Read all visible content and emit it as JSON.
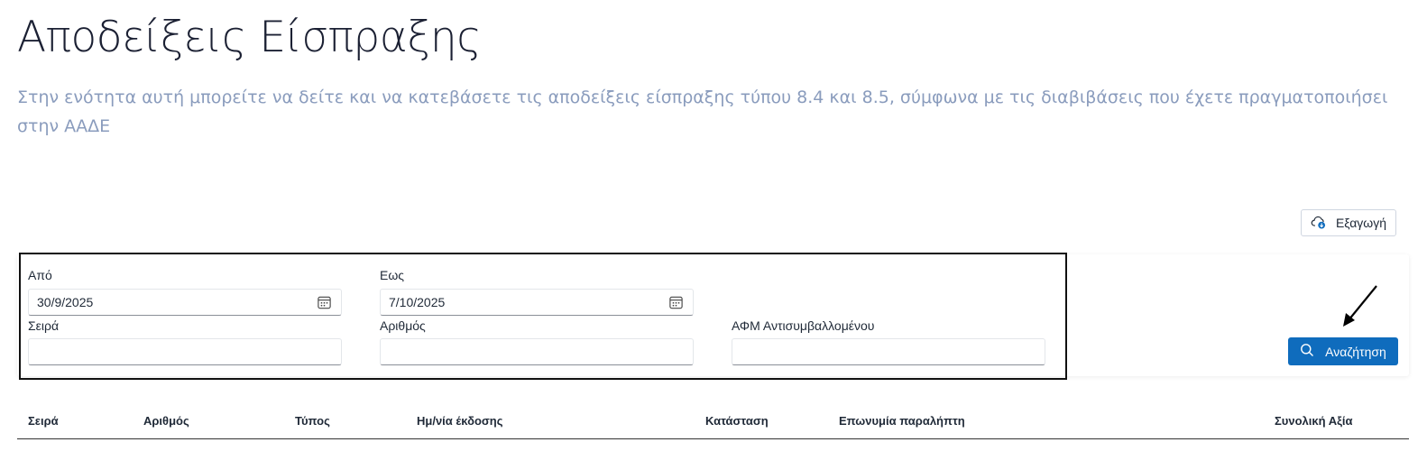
{
  "page": {
    "title": "Αποδείξεις Είσπραξης",
    "description": "Στην ενότητα αυτή μπορείτε να δείτε και να κατεβάσετε τις αποδείξεις είσπραξης τύπου 8.4 και 8.5, σύμφωνα με τις διαβιβάσεις που έχετε πραγματοποιήσει στην ΑΑΔΕ"
  },
  "toolbar": {
    "export_label": "Εξαγωγή",
    "export_icon": "cloud-download-icon"
  },
  "filters": {
    "from_label": "Από",
    "from_value": "30/9/2025",
    "to_label": "Εως",
    "to_value": "7/10/2025",
    "series_label": "Σειρά",
    "series_value": "",
    "number_label": "Αριθμός",
    "number_value": "",
    "vat_label": "ΑΦΜ Αντισυμβαλλομένου",
    "vat_value": "",
    "search_label": "Αναζήτηση",
    "search_icon": "search-icon"
  },
  "table": {
    "columns": [
      "Σειρά",
      "Αριθμός",
      "Τύπος",
      "Ημ/νία έκδοσης",
      "Κατάσταση",
      "Επωνυμία παραλήπτη",
      "Συνολική Αξία"
    ]
  },
  "colors": {
    "primary": "#0f6cbd",
    "title": "#1b2033",
    "description": "#8a9cbd"
  }
}
